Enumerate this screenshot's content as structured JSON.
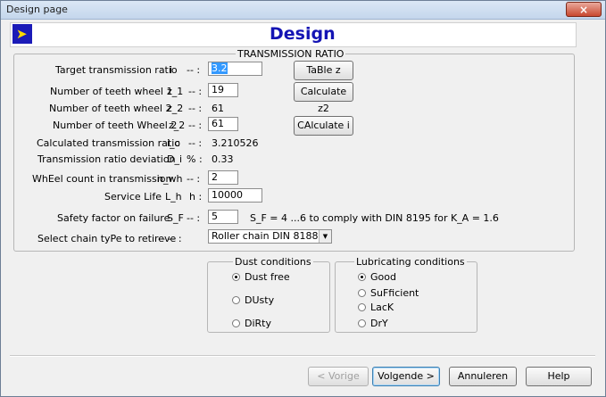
{
  "window": {
    "title": "Design page",
    "close_symbol": "×"
  },
  "header": {
    "title": "Design",
    "logo_icon": "yellow-arrow-logo"
  },
  "transmission": {
    "legend": "TRANSMISSION RATIO",
    "rows": {
      "target": {
        "label": "Target transmission ratio",
        "symbol": "i",
        "unit": "-- :",
        "value": "3.2"
      },
      "z1": {
        "label": "Number of teeth wheel 1",
        "symbol": "z_1",
        "unit": "-- :",
        "value": "19"
      },
      "z2_calc": {
        "label": "Number of teeth wheel 2",
        "symbol": "z_2",
        "unit": "-- :",
        "value": "61"
      },
      "z2_input": {
        "label": "Number of teeth Wheel 2",
        "symbol": "z_2",
        "unit": "-- :",
        "value": "61"
      },
      "ic": {
        "label": "Calculated transmission ratio",
        "symbol": "i_c",
        "unit": "-- :",
        "value": "3.210526"
      },
      "dev": {
        "label": "Transmission ratio deviation",
        "symbol": "D_i",
        "unit": "% :",
        "value": "0.33"
      },
      "nwh": {
        "label": "WhEel count in transmission",
        "symbol": "n_wh",
        "unit": "-- :",
        "value": "2"
      },
      "life": {
        "label": "Service Life",
        "symbol": "L_h",
        "unit": "h :",
        "value": "10000"
      },
      "sf": {
        "label": "Safety factor on failure",
        "symbol": "S_F",
        "unit": "-- :",
        "value": "5",
        "note": "S_F = 4 ...6  to comply with DIN 8195 for K_A = 1.6"
      },
      "chain": {
        "label": "Select chain tyPe to retireve",
        "unit": "--   -- :",
        "value": "Roller chain DIN 8188"
      }
    },
    "buttons": {
      "table_z": "TaBle z",
      "calc_z2": "Calculate z2",
      "calc_i": "CAlculate i"
    }
  },
  "dust": {
    "legend": "Dust conditions",
    "options": [
      "Dust free",
      "DUsty",
      "DiRty"
    ],
    "selected": 0
  },
  "lub": {
    "legend": "Lubricating conditions",
    "options": [
      "Good",
      "SuFficient",
      "LacK",
      "DrY"
    ],
    "selected": 0
  },
  "footer": {
    "prev": "< Vorige",
    "next": "Volgende >",
    "cancel": "Annuleren",
    "help": "Help"
  }
}
